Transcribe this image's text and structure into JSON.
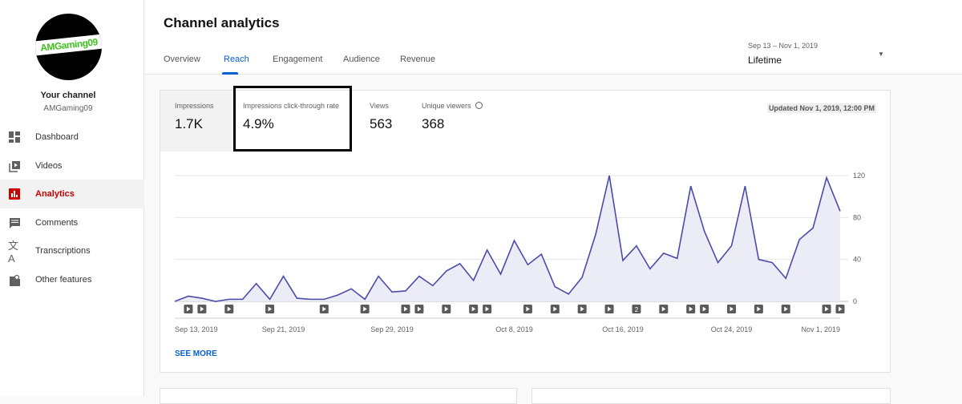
{
  "sidebar": {
    "avatar_text": "AMGaming09",
    "channel_title": "Your channel",
    "channel_name": "AMGaming09",
    "items": [
      {
        "label": "Dashboard",
        "icon": "dashboard-icon"
      },
      {
        "label": "Videos",
        "icon": "videos-icon"
      },
      {
        "label": "Analytics",
        "icon": "analytics-icon",
        "active": true
      },
      {
        "label": "Comments",
        "icon": "comments-icon"
      },
      {
        "label": "Transcriptions",
        "icon": "transcriptions-icon"
      },
      {
        "label": "Other features",
        "icon": "other-features-icon"
      }
    ]
  },
  "header": {
    "title": "Channel analytics",
    "tabs": [
      "Overview",
      "Reach",
      "Engagement",
      "Audience",
      "Revenue"
    ],
    "active_tab": "Reach",
    "date_range": "Sep 13 – Nov 1, 2019",
    "period": "Lifetime"
  },
  "metrics": [
    {
      "label": "Impressions",
      "value": "1.7K"
    },
    {
      "label": "Impressions click-through rate",
      "value": "4.9%"
    },
    {
      "label": "Views",
      "value": "563"
    },
    {
      "label": "Unique viewers",
      "value": "368"
    }
  ],
  "updated": "Updated Nov 1, 2019, 12:00 PM",
  "see_more": "SEE MORE",
  "colors": {
    "accent": "#065fd4",
    "line": "#4b4ba8",
    "fill": "#ececf7",
    "active_nav": "#cc0000"
  },
  "chart_data": {
    "type": "area",
    "title": "",
    "xlabel": "",
    "ylabel": "",
    "ylim": [
      0,
      120
    ],
    "y_ticks": [
      "0",
      "40",
      "80",
      "120"
    ],
    "x_tick_labels": [
      {
        "day": 0,
        "label": "Sep 13, 2019"
      },
      {
        "day": 8,
        "label": "Sep 21, 2019"
      },
      {
        "day": 16,
        "label": "Sep 29, 2019"
      },
      {
        "day": 25,
        "label": "Oct 8, 2019"
      },
      {
        "day": 33,
        "label": "Oct 16, 2019"
      },
      {
        "day": 41,
        "label": "Oct 24, 2019"
      },
      {
        "day": 49,
        "label": "Nov 1, 2019"
      }
    ],
    "series": [
      {
        "name": "Impressions",
        "values": [
          0,
          5,
          3,
          0,
          2,
          2,
          17,
          2,
          24,
          3,
          2,
          2,
          6,
          12,
          2,
          24,
          9,
          10,
          24,
          15,
          29,
          36,
          20,
          49,
          26,
          58,
          35,
          45,
          14,
          7,
          23,
          64,
          120,
          39,
          53,
          31,
          46,
          41,
          110,
          67,
          37,
          53,
          110,
          40,
          37,
          22,
          59,
          70,
          118,
          86
        ]
      }
    ],
    "video_markers": [
      {
        "day": 1,
        "label": ""
      },
      {
        "day": 2,
        "label": ""
      },
      {
        "day": 4,
        "label": ""
      },
      {
        "day": 7,
        "label": ""
      },
      {
        "day": 11,
        "label": ""
      },
      {
        "day": 14,
        "label": ""
      },
      {
        "day": 17,
        "label": ""
      },
      {
        "day": 18,
        "label": ""
      },
      {
        "day": 20,
        "label": ""
      },
      {
        "day": 22,
        "label": ""
      },
      {
        "day": 23,
        "label": ""
      },
      {
        "day": 26,
        "label": ""
      },
      {
        "day": 28,
        "label": ""
      },
      {
        "day": 30,
        "label": ""
      },
      {
        "day": 32,
        "label": ""
      },
      {
        "day": 34,
        "label": "2"
      },
      {
        "day": 36,
        "label": ""
      },
      {
        "day": 38,
        "label": ""
      },
      {
        "day": 39,
        "label": ""
      },
      {
        "day": 41,
        "label": ""
      },
      {
        "day": 43,
        "label": ""
      },
      {
        "day": 45,
        "label": ""
      },
      {
        "day": 48,
        "label": ""
      },
      {
        "day": 49,
        "label": ""
      }
    ]
  }
}
